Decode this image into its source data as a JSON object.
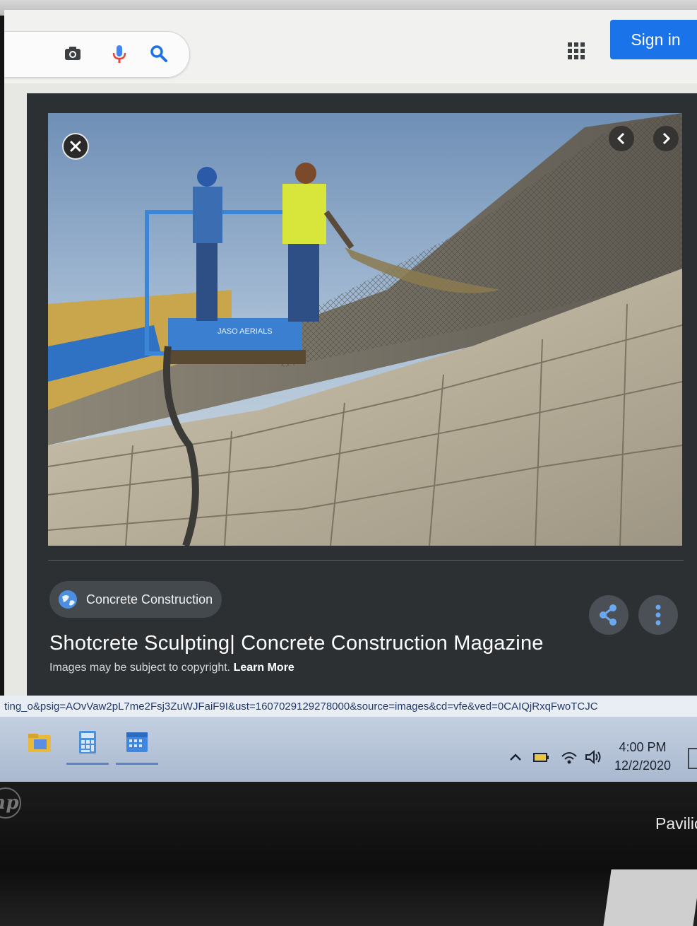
{
  "google_bar": {
    "signin_label": "Sign in",
    "icons": [
      "camera-icon",
      "microphone-icon",
      "search-icon",
      "apps-grid-icon"
    ],
    "brand_color": "#1a73e8"
  },
  "viewer": {
    "source_name": "Concrete Construction",
    "title": "Shotcrete Sculpting| Concrete Construction Magazine",
    "copyright_text": "Images may be subject to copyright.",
    "learn_more_label": "Learn More",
    "basket_label": "JASO AERIALS"
  },
  "status_url": "ting_o&psig=AOvVaw2pL7me2Fsj3ZuWJFaiF9I&ust=1607029129278000&source=images&cd=vfe&ved=0CAIQjRxqFwoTCJC",
  "taskbar": {
    "time": "4:00 PM",
    "date": "12/2/2020"
  },
  "device": {
    "brand_text": "Pavilic",
    "logo_text": "hp"
  }
}
